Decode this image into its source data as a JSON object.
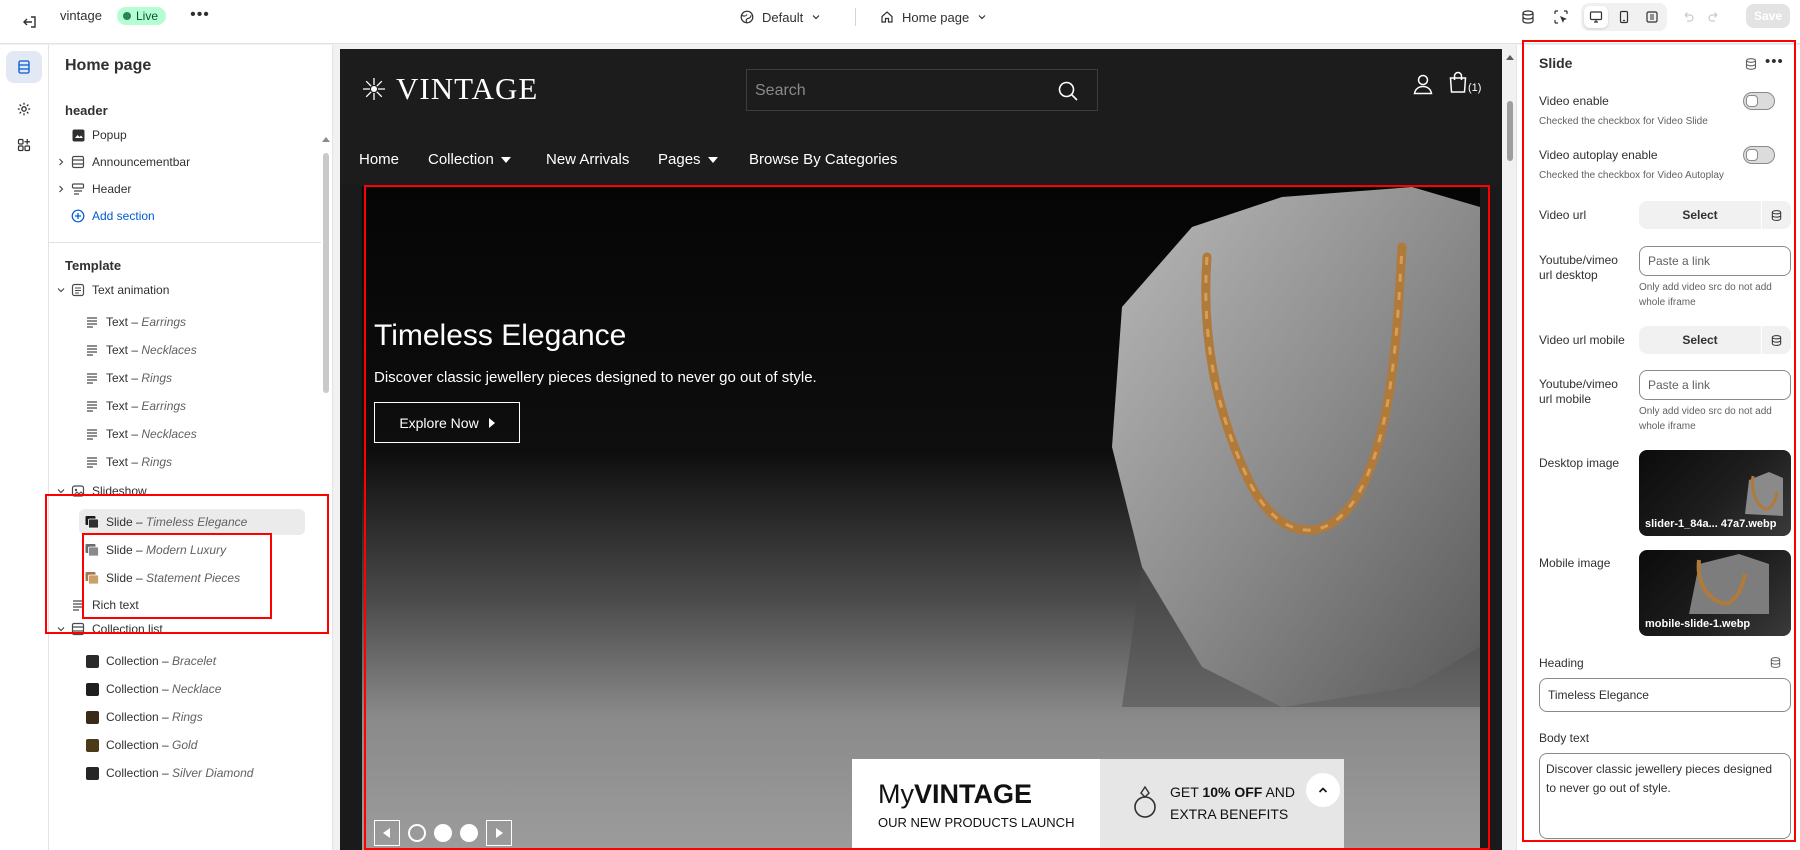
{
  "topbar": {
    "store_name": "vintage",
    "status_badge": "Live",
    "more_label": "•••",
    "theme_select": "Default",
    "page_select": "Home page",
    "save_label": "Save"
  },
  "sidebar": {
    "title": "Home page",
    "header_group": {
      "title": "header",
      "items": [
        {
          "label": "Popup"
        },
        {
          "label": "Announcementbar"
        },
        {
          "label": "Header"
        }
      ],
      "add_section": "Add section"
    },
    "template_group": {
      "title": "Template",
      "text_animation": "Text animation",
      "text_items": [
        {
          "prefix": "Text – ",
          "name": "Earrings"
        },
        {
          "prefix": "Text – ",
          "name": "Necklaces"
        },
        {
          "prefix": "Text – ",
          "name": "Rings"
        },
        {
          "prefix": "Text – ",
          "name": "Earrings"
        },
        {
          "prefix": "Text – ",
          "name": "Necklaces"
        },
        {
          "prefix": "Text – ",
          "name": "Rings"
        }
      ],
      "slideshow": "Slideshow",
      "slides": [
        {
          "prefix": "Slide – ",
          "name": "Timeless Elegance"
        },
        {
          "prefix": "Slide – ",
          "name": "Modern Luxury"
        },
        {
          "prefix": "Slide – ",
          "name": "Statement Pieces"
        }
      ],
      "rich_text": "Rich text",
      "collection_list": "Collection list",
      "collections": [
        {
          "prefix": "Collection – ",
          "name": "Bracelet"
        },
        {
          "prefix": "Collection – ",
          "name": "Necklace"
        },
        {
          "prefix": "Collection – ",
          "name": "Rings"
        },
        {
          "prefix": "Collection – ",
          "name": "Gold"
        },
        {
          "prefix": "Collection – ",
          "name": "Silver Diamond"
        }
      ]
    }
  },
  "preview": {
    "logo": "VINTAGE",
    "search_placeholder": "Search",
    "cart_count": "(1)",
    "nav": [
      "Home",
      "Collection",
      "New Arrivals",
      "Pages",
      "Browse By Categories"
    ],
    "hero": {
      "title": "Timeless Elegance",
      "subtitle": "Discover classic jewellery pieces designed to never go out of style.",
      "button": "Explore Now"
    },
    "promo": {
      "brand_light": "My",
      "brand_bold": "VINTAGE",
      "tagline": "OUR NEW PRODUCTS LAUNCH",
      "offer_line1_a": "GET ",
      "offer_line1_b": "10% OFF",
      "offer_line1_c": " AND",
      "offer_line2": "EXTRA BENEFITS"
    }
  },
  "settings": {
    "title": "Slide",
    "video_enable": "Video enable",
    "video_enable_help": "Checked the checkbox for Video Slide",
    "video_autoplay": "Video autoplay enable",
    "video_autoplay_help": "Checked the checkbox for Video Autoplay",
    "video_url": "Video url",
    "select_label": "Select",
    "yt_desktop_l1": "Youtube/vimeo",
    "yt_desktop_l2": "url desktop",
    "paste_placeholder": "Paste a link",
    "yt_help_l1": "Only add video src do not add",
    "yt_help_l2": "whole iframe",
    "video_url_mobile": "Video url mobile",
    "yt_mobile_l1": "Youtube/vimeo",
    "yt_mobile_l2": "url mobile",
    "desktop_image": "Desktop image",
    "desktop_image_file": "slider-1_84a... 47a7.webp",
    "mobile_image": "Mobile image",
    "mobile_image_file": "mobile-slide-1.webp",
    "heading_label": "Heading",
    "heading_value": "Timeless Elegance",
    "body_label": "Body text",
    "body_value": "Discover classic jewellery pieces designed to never go out of style."
  },
  "colors": {
    "accent_blue": "#005bd3",
    "live_green": "#29845a",
    "annotation_red": "#ff0000"
  }
}
